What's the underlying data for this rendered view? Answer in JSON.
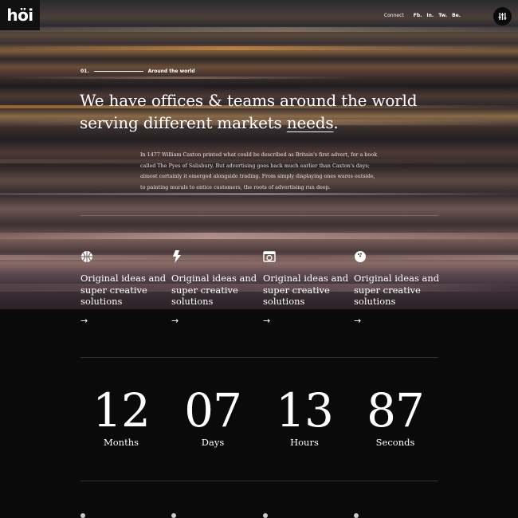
{
  "logo": {
    "text": "höi"
  },
  "nav": {
    "connect_label": "Connect",
    "social": [
      "Fb.",
      "In.",
      "Tw.",
      "Be."
    ],
    "menu_icon": "menu-bars-icon"
  },
  "hero": {
    "section_number": "01.",
    "section_title": "Around the world",
    "headline_line1": "We have offices & teams around the world",
    "headline_line2_prefix": "serving different markets ",
    "headline_underlined": "needs",
    "headline_suffix": ".",
    "intro": "In 1477 William Caxton printed what could be described as Britain's first advert, for a book called The Pyes of Salisbury. But advertising goes back much earlier than Caxton's days; almost certainly it emerged alongside trading. From simply displaying ones wares outside, to painting murals to entice customers, the roots of advertising run deep."
  },
  "features": [
    {
      "icon": "basketball-icon",
      "title": "Original ideas and super creative solutions",
      "arrow": "→"
    },
    {
      "icon": "lightning-icon",
      "title": "Original ideas and super creative solutions",
      "arrow": "→"
    },
    {
      "icon": "camera-icon",
      "title": "Original ideas and super creative solutions",
      "arrow": "→"
    },
    {
      "icon": "bowling-ball-icon",
      "title": "Original ideas and super creative solutions",
      "arrow": "→"
    }
  ],
  "counters": [
    {
      "value": "12",
      "label": "Months"
    },
    {
      "value": "07",
      "label": "Days"
    },
    {
      "value": "13",
      "label": "Hours"
    },
    {
      "value": "87",
      "label": "Seconds"
    }
  ],
  "colors": {
    "background": "#0a0a0a",
    "text": "#ffffff",
    "logo_bg": "#111111"
  }
}
